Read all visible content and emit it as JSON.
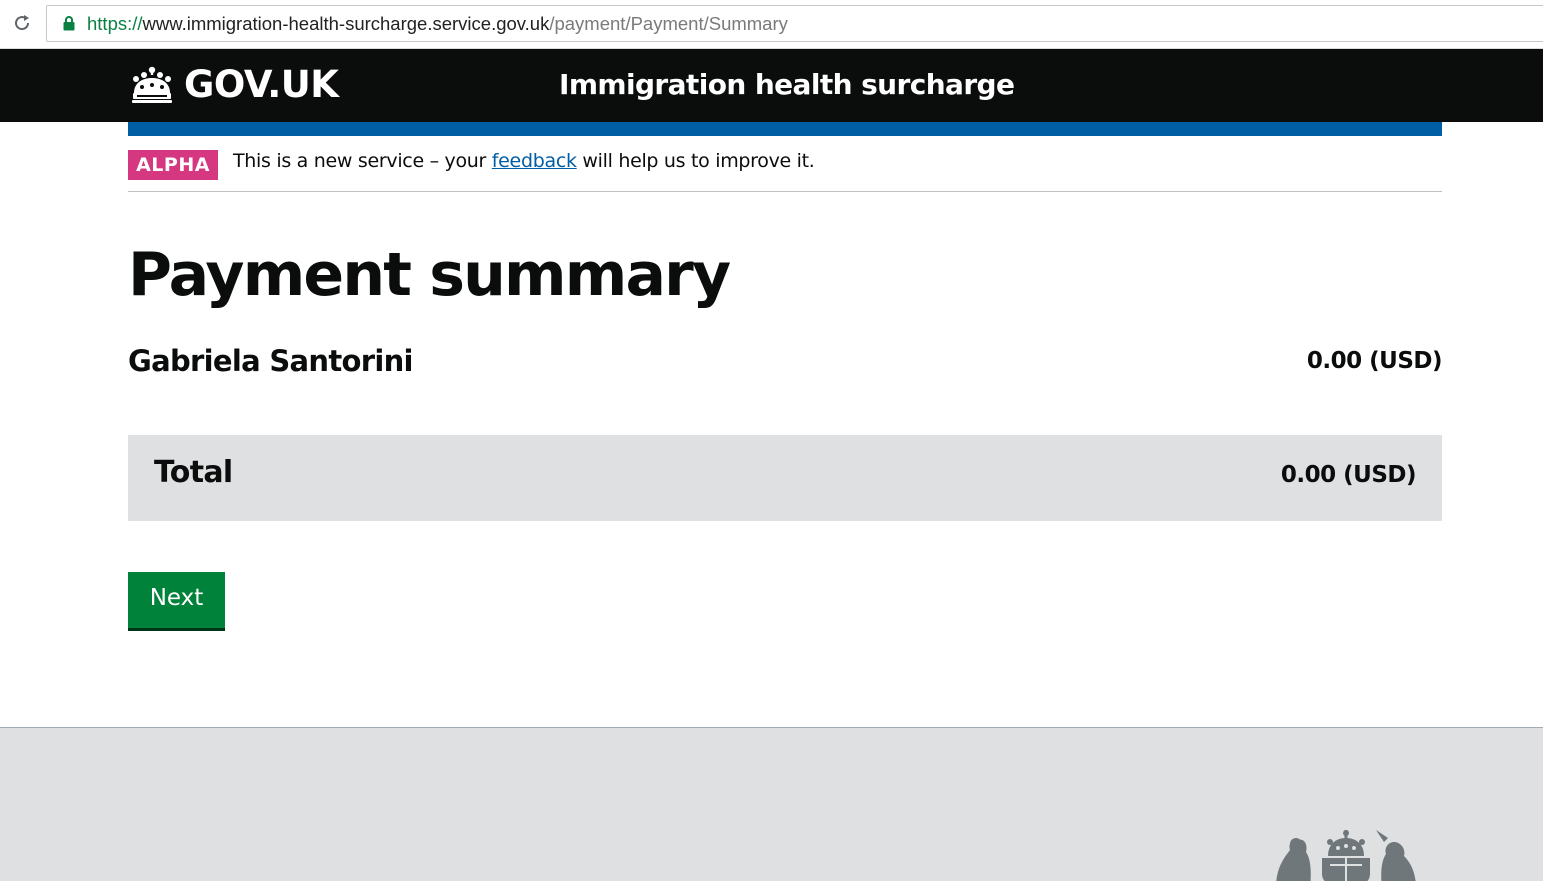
{
  "browser": {
    "url_scheme": "https://",
    "url_host": "www.immigration-health-surcharge.service.gov.uk",
    "url_path": "/payment/Payment/Summary"
  },
  "header": {
    "logo_text": "GOV.UK",
    "service_name": "Immigration health surcharge",
    "logo_icon": "crown-icon"
  },
  "phase_banner": {
    "tag": "ALPHA",
    "text_before": "This is a new service – your ",
    "link_text": "feedback",
    "text_after": " will help us to improve it."
  },
  "main": {
    "title": "Payment summary",
    "rows": [
      {
        "name": "Gabriela Santorini",
        "amount": "0.00 (USD)"
      }
    ],
    "total": {
      "label": "Total",
      "amount": "0.00 (USD)"
    },
    "next_button": "Next"
  },
  "footer": {
    "crest_icon": "royal-coat-of-arms-icon"
  },
  "colors": {
    "header_bg": "#0b0c0c",
    "blue_bar": "#005ea5",
    "alpha_tag": "#d53880",
    "button_green": "#00823b",
    "footer_bg": "#dee0e2",
    "link": "#005ea5"
  }
}
